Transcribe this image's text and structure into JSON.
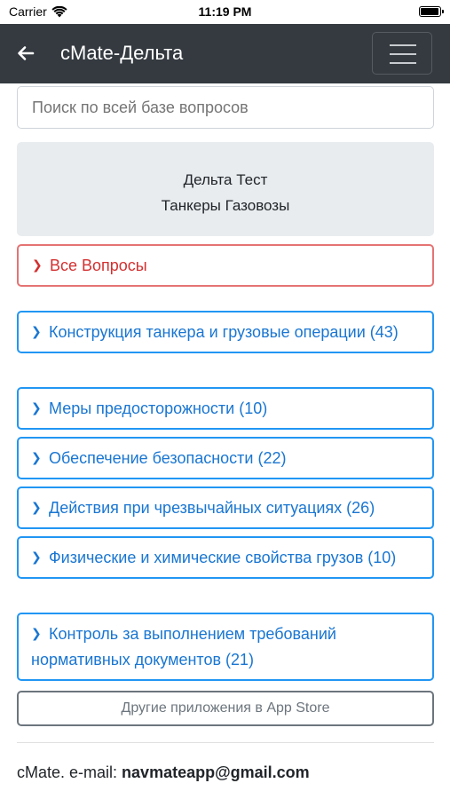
{
  "status": {
    "carrier": "Carrier",
    "time": "11:19 PM"
  },
  "nav": {
    "title": "cMate-Дельта"
  },
  "search": {
    "placeholder": "Поиск по всей базе вопросов"
  },
  "title_card": {
    "line1": "Дельта Тест",
    "line2": "Танкеры Газовозы"
  },
  "all_questions": {
    "label": "Все Вопросы"
  },
  "categories": [
    {
      "label": "Конструкция танкера и грузовые операции (43)"
    },
    {
      "label": "Меры предосторожности (10)"
    },
    {
      "label": "Обеспечение безопасности (22)"
    },
    {
      "label": "Действия при чрезвычайных ситуациях (26)"
    },
    {
      "label": "Физические и химические свойства грузов (10)"
    },
    {
      "label": "Контроль за выполнением требований нормативных документов (21)"
    }
  ],
  "store_button": {
    "label": "Другие приложения в App Store"
  },
  "footer": {
    "prefix": "cMate. e-mail:",
    "email": "navmateapp@gmail.com"
  },
  "colors": {
    "navbar": "#343a40",
    "accent": "#2196f3",
    "danger": "#e57373"
  }
}
